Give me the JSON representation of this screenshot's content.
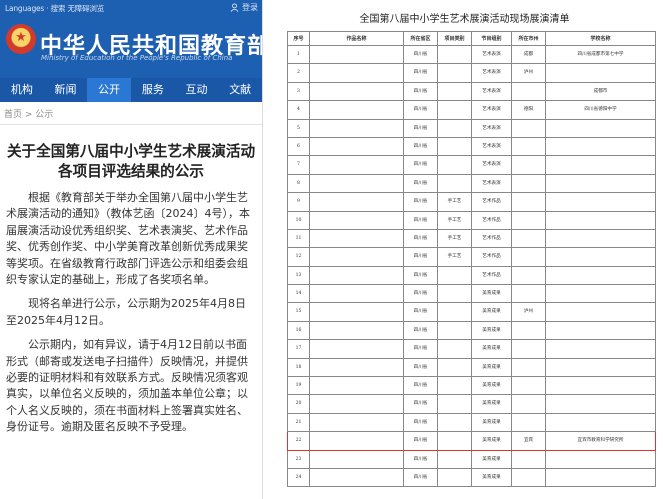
{
  "site": {
    "lang_line": "Languages · 搜索 无障碍浏览",
    "login": "登录",
    "title": "中华人民共和国教育部",
    "subtitle": "Ministry of Education of the People's Republic of China"
  },
  "nav": [
    {
      "label": "机构"
    },
    {
      "label": "新闻"
    },
    {
      "label": "公开"
    },
    {
      "label": "服务"
    },
    {
      "label": "互动"
    },
    {
      "label": "文献"
    }
  ],
  "breadcrumb": "首页 > 公示",
  "article": {
    "title": "关于全国第八届中小学生艺术展演活动各项目评选结果的公示",
    "paragraphs": [
      "根据《教育部关于举办全国第八届中小学生艺术展演活动的通知》（教体艺函〔2024〕4号），本届展演活动设优秀组织奖、艺术表演奖、艺术作品奖、优秀创作奖、中小学美育改革创新优秀成果奖等奖项。在省级教育行政部门评选公示和组委会组织专家认定的基础上，形成了各奖项名单。",
      "现将名单进行公示，公示期为2025年4月8日至2025年4月12日。",
      "公示期内，如有异议，请于4月12日前以书面形式（邮寄或发送电子扫描件）反映情况，并提供必要的证明材料和有效联系方式。反映情况须客观真实，以单位名义反映的，须加盖本单位公章；以个人名义反映的，须在书面材料上签署真实姓名、身份证号。逾期及匿名反映不予受理。"
    ]
  },
  "document": {
    "title": "全国第八届中小学生艺术展演活动现场展演清单",
    "headers": [
      "序号",
      "作品名称",
      "所在省区",
      "项目类别",
      "节目组别",
      "所在市州",
      "学校名称"
    ],
    "rows": [
      [
        "1",
        "",
        "四川省",
        "",
        "艺术表演",
        "成都",
        "四川省成都市第七中学"
      ],
      [
        "2",
        "",
        "四川省",
        "",
        "艺术表演",
        "泸州",
        ""
      ],
      [
        "3",
        "",
        "四川省",
        "",
        "艺术表演",
        "",
        "成都市"
      ],
      [
        "4",
        "",
        "四川省",
        "",
        "艺术表演",
        "德阳",
        "四川省德阳中学"
      ],
      [
        "5",
        "",
        "四川省",
        "",
        "艺术表演",
        "",
        ""
      ],
      [
        "6",
        "",
        "四川省",
        "",
        "艺术表演",
        "",
        ""
      ],
      [
        "7",
        "",
        "四川省",
        "",
        "艺术表演",
        "",
        ""
      ],
      [
        "8",
        "",
        "四川省",
        "",
        "艺术表演",
        "",
        ""
      ],
      [
        "9",
        "",
        "四川省",
        "手工艺",
        "艺术作品",
        "",
        ""
      ],
      [
        "10",
        "",
        "四川省",
        "手工艺",
        "艺术作品",
        "",
        ""
      ],
      [
        "11",
        "",
        "四川省",
        "手工艺",
        "艺术作品",
        "",
        ""
      ],
      [
        "12",
        "",
        "四川省",
        "手工艺",
        "艺术作品",
        "",
        ""
      ],
      [
        "13",
        "",
        "四川省",
        "",
        "艺术作品",
        "",
        ""
      ],
      [
        "14",
        "",
        "四川省",
        "",
        "美育成果",
        "",
        ""
      ],
      [
        "15",
        "",
        "四川省",
        "",
        "美育成果",
        "泸州",
        ""
      ],
      [
        "16",
        "",
        "四川省",
        "",
        "美育成果",
        "",
        ""
      ],
      [
        "17",
        "",
        "四川省",
        "",
        "美育成果",
        "",
        ""
      ],
      [
        "18",
        "",
        "四川省",
        "",
        "美育成果",
        "",
        ""
      ],
      [
        "19",
        "",
        "四川省",
        "",
        "美育成果",
        "",
        ""
      ],
      [
        "20",
        "",
        "四川省",
        "",
        "美育成果",
        "",
        ""
      ],
      [
        "21",
        "",
        "四川省",
        "",
        "美育成果",
        "",
        ""
      ],
      [
        "22",
        "",
        "四川省",
        "",
        "美育成果",
        "宜宾",
        "宜宾市教育科学研究所"
      ],
      [
        "23",
        "",
        "四川省",
        "",
        "美育成果",
        "",
        ""
      ],
      [
        "24",
        "",
        "四川省",
        "",
        "美育成果",
        "",
        ""
      ]
    ],
    "highlight_row_index": 21,
    "highlight_color": "#e23030"
  }
}
